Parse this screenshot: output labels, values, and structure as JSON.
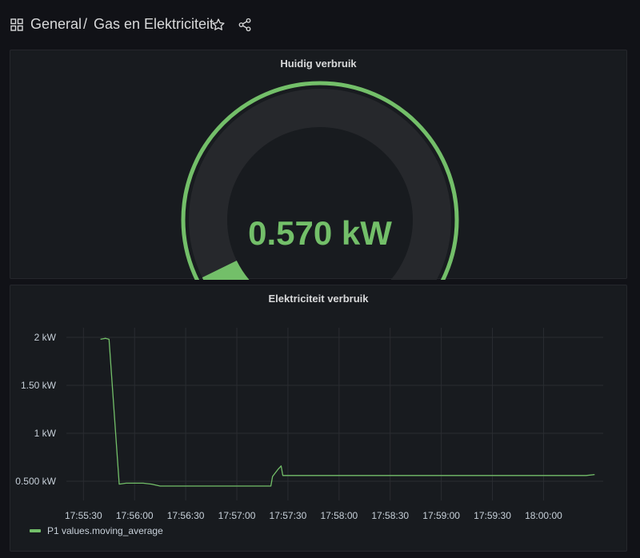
{
  "header": {
    "folder": "General",
    "separator": "/",
    "dashboard_title": "Gas en Elektriciteit",
    "icons": {
      "apps": "apps-grid-icon",
      "star": "star-icon",
      "share": "share-icon"
    }
  },
  "gauge_panel": {
    "title": "Huidig verbruik",
    "value_text": "0.570 kW",
    "value": 0.57,
    "unit": "kW",
    "fill_fraction": 0.07,
    "colors": {
      "value": "#73bf69",
      "track": "#26282c",
      "outer_ring": "#73bf69"
    }
  },
  "graph_panel": {
    "title": "Elektriciteit verbruik",
    "legend": [
      {
        "name": "P1 values.moving_average",
        "color": "#73bf69"
      }
    ]
  },
  "chart_data": {
    "type": "line",
    "title": "Elektriciteit verbruik",
    "xlabel": "",
    "ylabel": "",
    "x_ticks": [
      "17:55:30",
      "17:56:00",
      "17:56:30",
      "17:57:00",
      "17:57:30",
      "17:58:00",
      "17:58:30",
      "17:59:00",
      "17:59:30",
      "18:00:00"
    ],
    "y_ticks": [
      "0.500 kW",
      "1 kW",
      "1.50 kW",
      "2 kW"
    ],
    "y_tick_values": [
      0.5,
      1.0,
      1.5,
      2.0
    ],
    "ylim": [
      0.3,
      2.1
    ],
    "xlim": [
      "17:55:20",
      "18:00:35"
    ],
    "grid": true,
    "legend_position": "bottom-left",
    "series": [
      {
        "name": "P1 values.moving_average",
        "color": "#73bf69",
        "points": [
          [
            "17:55:40",
            1.98
          ],
          [
            "17:55:43",
            1.99
          ],
          [
            "17:55:45",
            1.98
          ],
          [
            "17:55:51",
            0.47
          ],
          [
            "17:55:55",
            0.48
          ],
          [
            "17:56:00",
            0.48
          ],
          [
            "17:56:05",
            0.48
          ],
          [
            "17:56:10",
            0.47
          ],
          [
            "17:56:15",
            0.45
          ],
          [
            "17:56:30",
            0.45
          ],
          [
            "17:56:45",
            0.45
          ],
          [
            "17:57:00",
            0.45
          ],
          [
            "17:57:10",
            0.45
          ],
          [
            "17:57:15",
            0.45
          ],
          [
            "17:57:20",
            0.45
          ],
          [
            "17:57:21",
            0.55
          ],
          [
            "17:57:24",
            0.62
          ],
          [
            "17:57:26",
            0.66
          ],
          [
            "17:57:27",
            0.56
          ],
          [
            "17:57:45",
            0.56
          ],
          [
            "17:58:15",
            0.56
          ],
          [
            "17:58:45",
            0.56
          ],
          [
            "17:59:15",
            0.56
          ],
          [
            "17:59:45",
            0.56
          ],
          [
            "18:00:10",
            0.56
          ],
          [
            "18:00:25",
            0.56
          ],
          [
            "18:00:30",
            0.57
          ]
        ]
      }
    ]
  }
}
